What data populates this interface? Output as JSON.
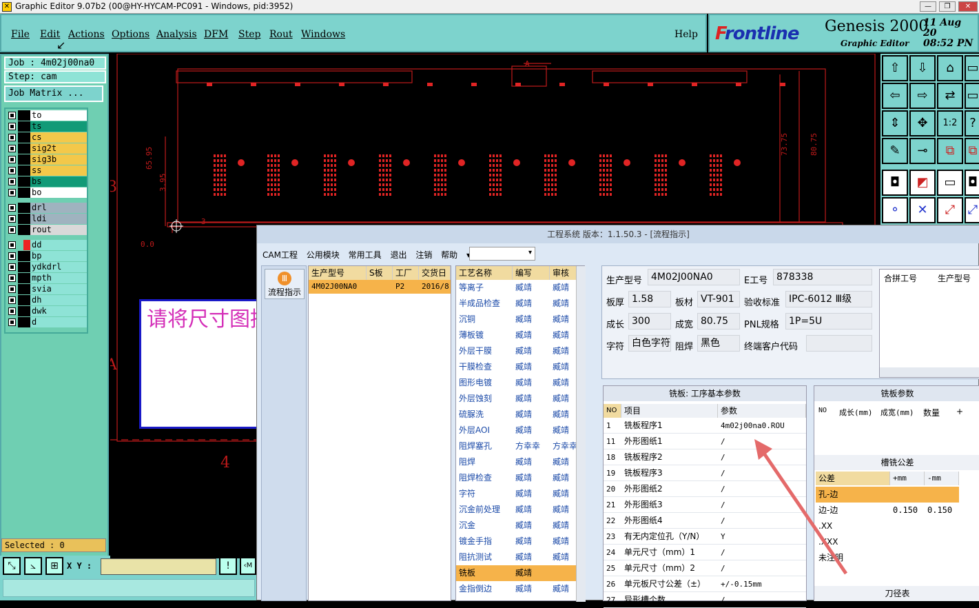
{
  "window": {
    "title": "Graphic Editor 9.07b2 (00@HY-HYCAM-PC091 - Windows, pid:3952)"
  },
  "menu": [
    "File",
    "Edit",
    "Actions",
    "Options",
    "Analysis",
    "DFM",
    "Step",
    "Rout",
    "Windows"
  ],
  "help": "Help",
  "brand": {
    "frontline_a": "F",
    "frontline_b": "rontline",
    "product": "Genesis 2000",
    "sub": "Graphic Editor",
    "date": "11 Aug 20",
    "time": "08:52 PN"
  },
  "job": {
    "job_label": "Job : 4m02j00na0",
    "step_label": "Step: cam",
    "matrix": "Job Matrix ..."
  },
  "layers": [
    {
      "name": "to",
      "color": "#ffffff"
    },
    {
      "name": "ts",
      "color": "#119a77"
    },
    {
      "name": "cs",
      "color": "#f3c84a"
    },
    {
      "name": "sig2t",
      "color": "#f3c84a"
    },
    {
      "name": "sig3b",
      "color": "#f3c84a"
    },
    {
      "name": "ss",
      "color": "#f3c84a"
    },
    {
      "name": "bs",
      "color": "#119a77"
    },
    {
      "name": "bo",
      "color": "#ffffff"
    },
    {
      "name": "drl",
      "color": "#9fb3bf"
    },
    {
      "name": "ldi",
      "color": "#9fb3bf"
    },
    {
      "name": "rout",
      "color": "#d9d9d9"
    },
    {
      "name": "dd",
      "color": "#8ee3d6"
    },
    {
      "name": "bp",
      "color": "#8ee3d6"
    },
    {
      "name": "ydkdrl",
      "color": "#8ee3d6"
    },
    {
      "name": "mpth",
      "color": "#8ee3d6"
    },
    {
      "name": "svia",
      "color": "#8ee3d6"
    },
    {
      "name": "dh",
      "color": "#8ee3d6"
    },
    {
      "name": "dwk",
      "color": "#8ee3d6"
    },
    {
      "name": "d",
      "color": "#8ee3d6"
    }
  ],
  "selected": "Selected : 0",
  "xy_label": "X Y :",
  "canvas": {
    "dim1": "65.95",
    "dim2": "3.95",
    "dim3": "73.75",
    "dim4": "80.75",
    "origin": "0.0",
    "tick3": "3",
    "mark3": "3",
    "mark4": "4",
    "markA": "A",
    "markA2": "A"
  },
  "popup": {
    "text": "请将尺寸图提供给生产"
  },
  "cam": {
    "title": "工程系统   版本：1.1.50.3 - [流程指示]",
    "menu": [
      "CAM工程",
      "公用模块",
      "常用工具",
      "退出",
      "注销",
      "帮助"
    ],
    "side_button": "流程指示",
    "orders": {
      "headers": [
        "生产型号",
        "S板",
        "工厂",
        "交货日"
      ],
      "row": [
        "4M02J00NA0",
        "",
        "P2",
        "2016/8"
      ]
    },
    "process": {
      "headers": [
        "工艺名称",
        "编写",
        "审核"
      ],
      "rows": [
        [
          "等离子",
          "臧靖",
          "臧靖"
        ],
        [
          "半成品检查",
          "臧靖",
          "臧靖"
        ],
        [
          "沉铜",
          "臧靖",
          "臧靖"
        ],
        [
          "薄板镀",
          "臧靖",
          "臧靖"
        ],
        [
          "外层干膜",
          "臧靖",
          "臧靖"
        ],
        [
          "干膜检查",
          "臧靖",
          "臧靖"
        ],
        [
          "图形电镀",
          "臧靖",
          "臧靖"
        ],
        [
          "外层蚀刻",
          "臧靖",
          "臧靖"
        ],
        [
          "硫脲洗",
          "臧靖",
          "臧靖"
        ],
        [
          "外层AOI",
          "臧靖",
          "臧靖"
        ],
        [
          "阻焊塞孔",
          "方幸幸",
          "方幸幸"
        ],
        [
          "阻焊",
          "臧靖",
          "臧靖"
        ],
        [
          "阻焊检查",
          "臧靖",
          "臧靖"
        ],
        [
          "字符",
          "臧靖",
          "臧靖"
        ],
        [
          "沉金前处理",
          "臧靖",
          "臧靖"
        ],
        [
          "沉金",
          "臧靖",
          "臧靖"
        ],
        [
          "镀金手指",
          "臧靖",
          "臧靖"
        ],
        [
          "阻抗测试",
          "臧靖",
          "臧靖"
        ],
        [
          "铣板",
          "臧靖",
          ""
        ],
        [
          "金指倒边",
          "臧靖",
          "臧靖"
        ]
      ]
    },
    "info": {
      "model_label": "生产型号",
      "model": "4M02J00NA0",
      "eno_label": "E工号",
      "eno": "878338",
      "thick_label": "板厚",
      "thick": "1.58",
      "mat_label": "板材",
      "mat": "VT-901",
      "std_label": "验收标准",
      "std": "IPC-6012 Ⅲ级",
      "len_label": "成长",
      "len": "300",
      "wid_label": "成宽",
      "wid": "80.75",
      "pnl_label": "PNL规格",
      "pnl": "1P=5U",
      "char_label": "字符",
      "char": "白色字符",
      "mask_label": "阻焊",
      "mask": "黑色",
      "cust_label": "终端客户代码",
      "cust": ""
    },
    "merge": {
      "headers": [
        "合拼工号",
        "生产型号"
      ]
    },
    "params": {
      "title": "铣板: 工序基本参数",
      "headers": [
        "NO",
        "项目",
        "参数"
      ],
      "rows": [
        [
          "1",
          "铣板程序1",
          "4m02j00na0.ROU"
        ],
        [
          "11",
          "外形图纸1",
          "/"
        ],
        [
          "18",
          "铣板程序2",
          "/"
        ],
        [
          "19",
          "铣板程序3",
          "/"
        ],
        [
          "20",
          "外形图纸2",
          "/"
        ],
        [
          "21",
          "外形图纸3",
          "/"
        ],
        [
          "22",
          "外形图纸4",
          "/"
        ],
        [
          "23",
          "有无内定位孔（Y/N）",
          "Y"
        ],
        [
          "24",
          "单元尺寸（mm）1",
          "/"
        ],
        [
          "25",
          "单元尺寸（mm）2",
          "/"
        ],
        [
          "26",
          "单元板尺寸公差（±）",
          "+/-0.15mm"
        ],
        [
          "27",
          "异形槽个数",
          "/"
        ]
      ]
    },
    "mill": {
      "title": "铣板参数",
      "headers": [
        "NO",
        "成长(mm)",
        "成宽(mm)",
        "数量",
        "+"
      ]
    },
    "slot": {
      "title": "槽铣公差",
      "headers": [
        "公差",
        "+mm",
        "-mm"
      ],
      "rows": [
        [
          "孔-边",
          "",
          ""
        ],
        [
          "边-边",
          "0.150",
          "0.150"
        ],
        [
          ".XX",
          "",
          ""
        ],
        [
          ".XXX",
          "",
          ""
        ],
        [
          "未注明",
          "",
          ""
        ]
      ]
    },
    "tool": {
      "title": "刀径表"
    }
  }
}
